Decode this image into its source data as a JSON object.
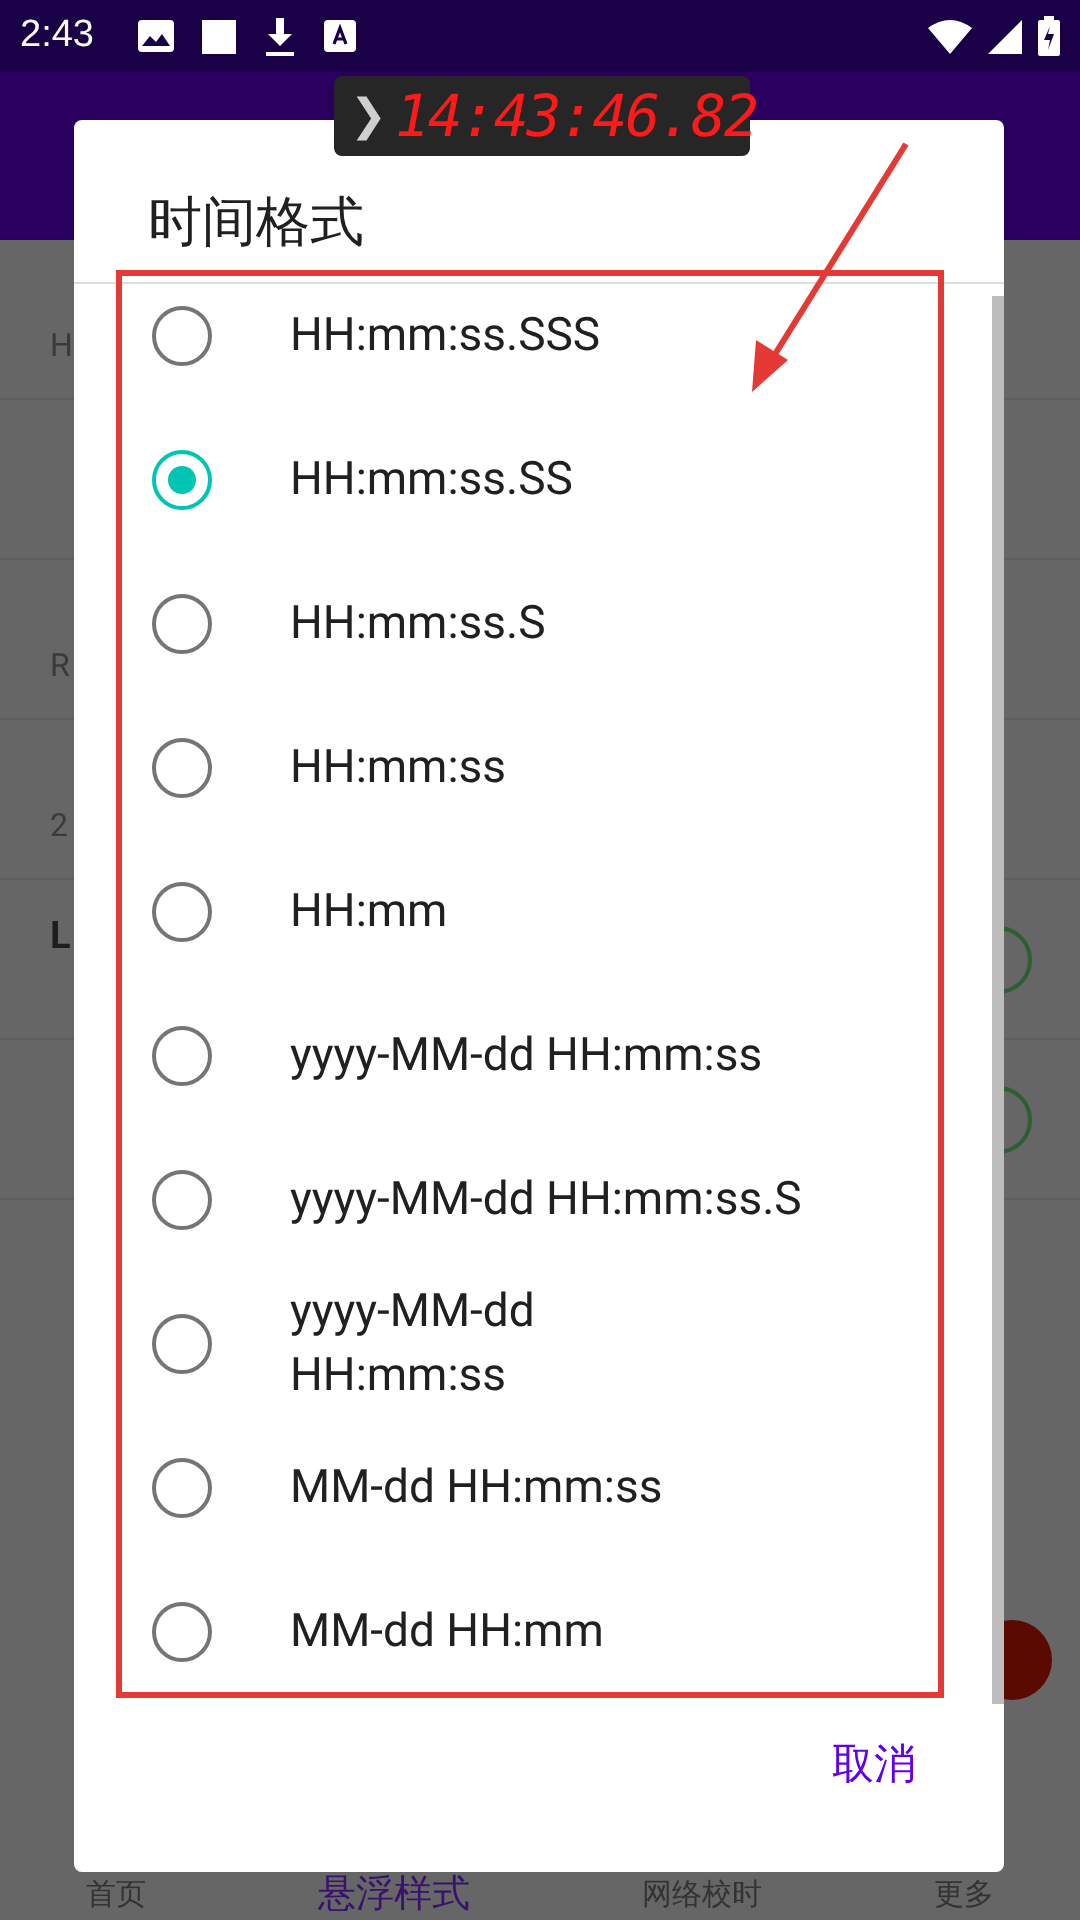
{
  "status_bar": {
    "time": "2:43"
  },
  "settings": [
    {
      "subtitle": "H",
      "kind": "plain"
    },
    {
      "kind": "plain"
    },
    {
      "subtitle": "R",
      "kind": "plain"
    },
    {
      "subtitle": "2",
      "kind": "plain"
    },
    {
      "title": "L",
      "kind": "switch"
    },
    {
      "kind": "switch"
    }
  ],
  "floating_clock": {
    "arrow": "❯",
    "time": "14:43:46.82"
  },
  "dialog": {
    "title": "时间格式",
    "options": [
      {
        "label": "HH:mm:ss.SSS",
        "selected": false
      },
      {
        "label": "HH:mm:ss.SS",
        "selected": true
      },
      {
        "label": "HH:mm:ss.S",
        "selected": false
      },
      {
        "label": "HH:mm:ss",
        "selected": false
      },
      {
        "label": "HH:mm",
        "selected": false
      },
      {
        "label": "yyyy-MM-dd HH:mm:ss",
        "selected": false
      },
      {
        "label": "yyyy-MM-dd HH:mm:ss.S",
        "selected": false
      },
      {
        "label": "yyyy-MM-dd\nHH:mm:ss",
        "selected": false
      },
      {
        "label": "MM-dd HH:mm:ss",
        "selected": false
      },
      {
        "label": "MM-dd HH:mm",
        "selected": false
      }
    ],
    "cancel": "取消"
  },
  "bottom_nav": [
    {
      "label": "首页",
      "selected": false
    },
    {
      "label": "悬浮样式",
      "selected": true
    },
    {
      "label": "网络校时",
      "selected": false
    },
    {
      "label": "更多",
      "selected": false
    }
  ]
}
